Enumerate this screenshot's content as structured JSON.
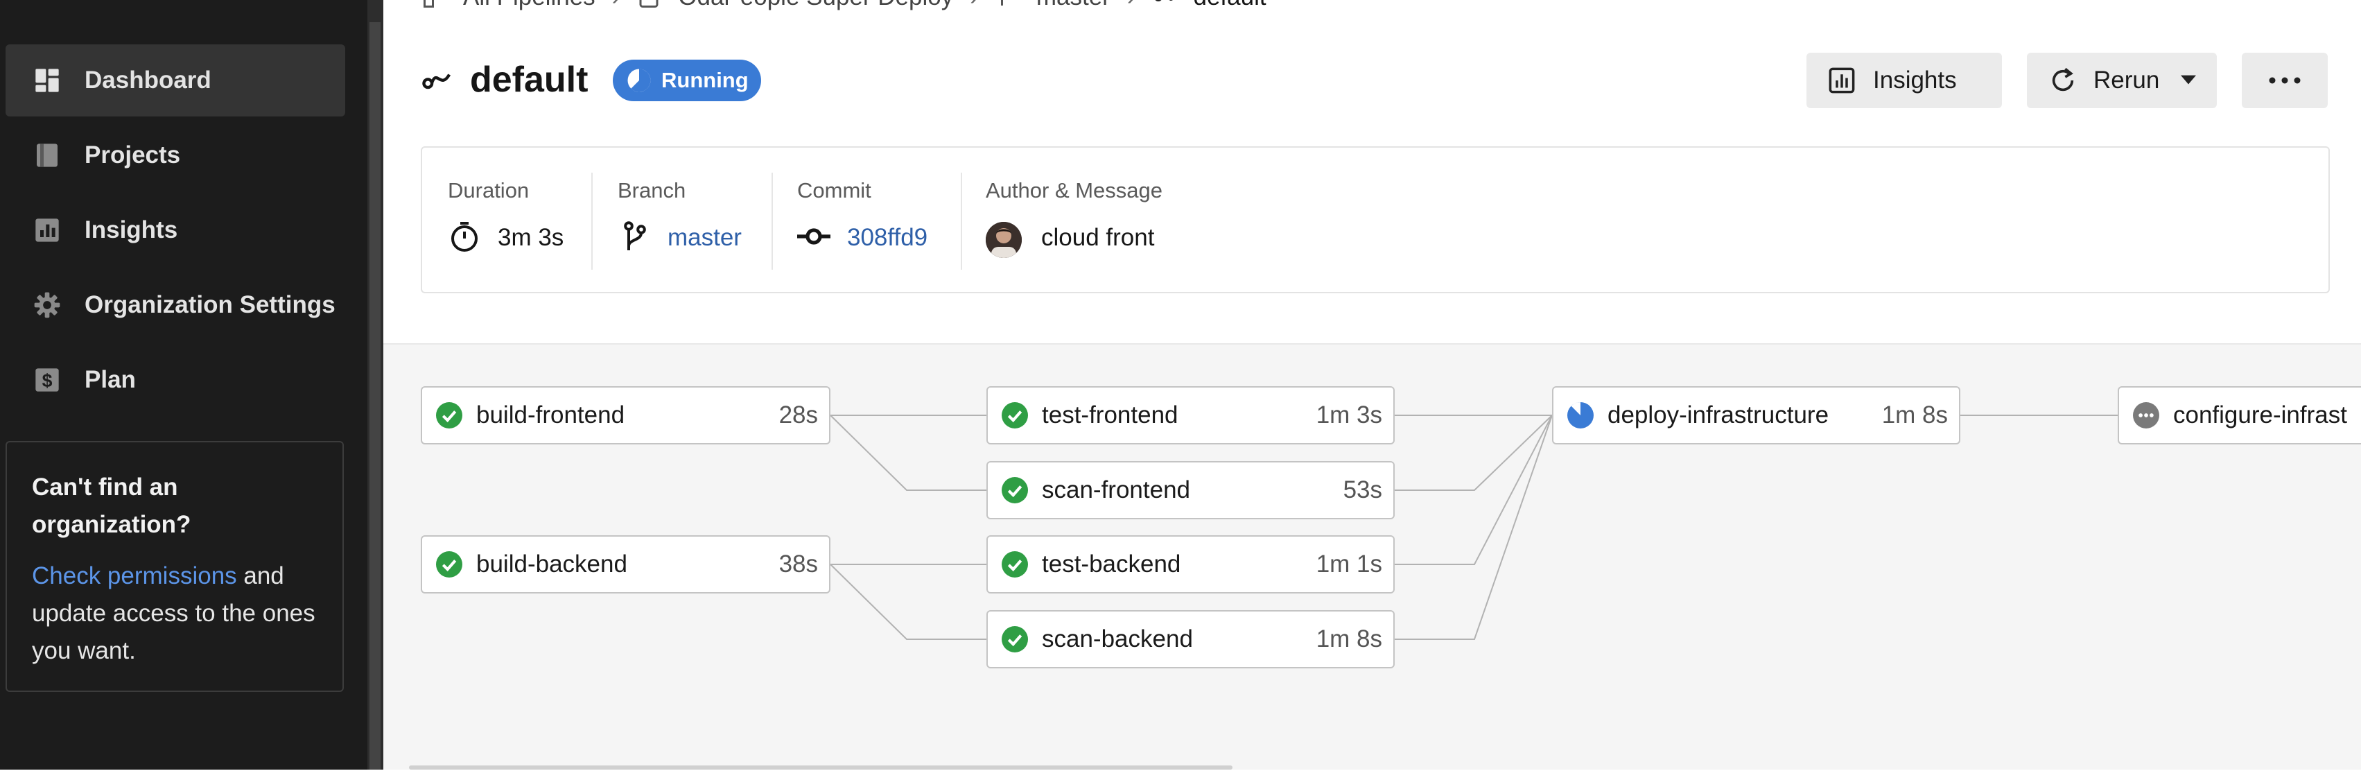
{
  "sidebar": {
    "items": [
      {
        "label": "Dashboard",
        "icon": "dashboard-icon",
        "active": true
      },
      {
        "label": "Projects",
        "icon": "projects-icon"
      },
      {
        "label": "Insights",
        "icon": "insights-icon"
      },
      {
        "label": "Organization Settings",
        "icon": "gear-icon"
      },
      {
        "label": "Plan",
        "icon": "dollar-icon"
      }
    ],
    "help": {
      "title": "Can't find an organization?",
      "link": "Check permissions",
      "rest": " and update access to the ones you want."
    }
  },
  "breadcrumb": {
    "items": [
      "All Pipelines",
      "Odar-eople Super Deploy",
      "master",
      "default"
    ]
  },
  "header": {
    "title": "default",
    "status": "Running",
    "insights_label": "Insights",
    "rerun_label": "Rerun"
  },
  "info": {
    "duration": {
      "label": "Duration",
      "value": "3m 3s"
    },
    "branch": {
      "label": "Branch",
      "value": "master"
    },
    "commit": {
      "label": "Commit",
      "value": "308ffd9"
    },
    "author": {
      "label": "Author & Message",
      "value": "cloud front"
    }
  },
  "jobs": [
    {
      "name": "build-frontend",
      "duration": "28s",
      "status": "success"
    },
    {
      "name": "build-backend",
      "duration": "38s",
      "status": "success"
    },
    {
      "name": "test-frontend",
      "duration": "1m 3s",
      "status": "success"
    },
    {
      "name": "scan-frontend",
      "duration": "53s",
      "status": "success"
    },
    {
      "name": "test-backend",
      "duration": "1m 1s",
      "status": "success"
    },
    {
      "name": "scan-backend",
      "duration": "1m 8s",
      "status": "success"
    },
    {
      "name": "deploy-infrastructure",
      "duration": "1m 8s",
      "status": "running"
    },
    {
      "name": "configure-infrast",
      "duration": "",
      "status": "pending"
    }
  ],
  "colors": {
    "sidebar_bg": "#1c1c1c",
    "accent": "#3a7bd5",
    "success": "#2f9e44",
    "link": "#2e5fa8"
  }
}
